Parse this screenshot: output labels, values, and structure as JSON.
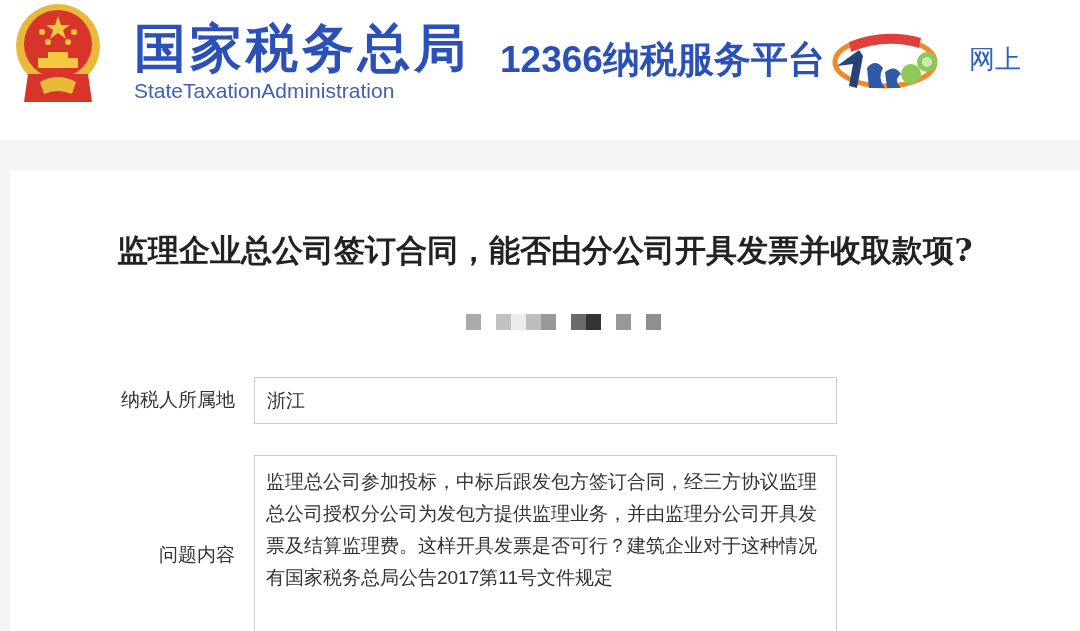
{
  "header": {
    "agency_name": "国家税务总局",
    "agency_name_en": "StateTaxationAdministration",
    "platform_name": "12366纳税服务平台",
    "nav_link": "网上"
  },
  "question": {
    "title": "监理企业总公司签订合同，能否由分公司开具发票并收取款项?",
    "fields": [
      {
        "kind": "input",
        "label": "纳税人所属地",
        "value": "浙江"
      },
      {
        "kind": "textarea",
        "label": "问题内容",
        "value": "监理总公司参加投标，中标后跟发包方签订合同，经三方协议监理总公司授权分公司为发包方提供监理业务，并由监理分公司开具发票及结算监理费。这样开具发票是否可行？建筑企业对于这种情况有国家税务总局公告2017第11号文件规定"
      }
    ]
  }
}
